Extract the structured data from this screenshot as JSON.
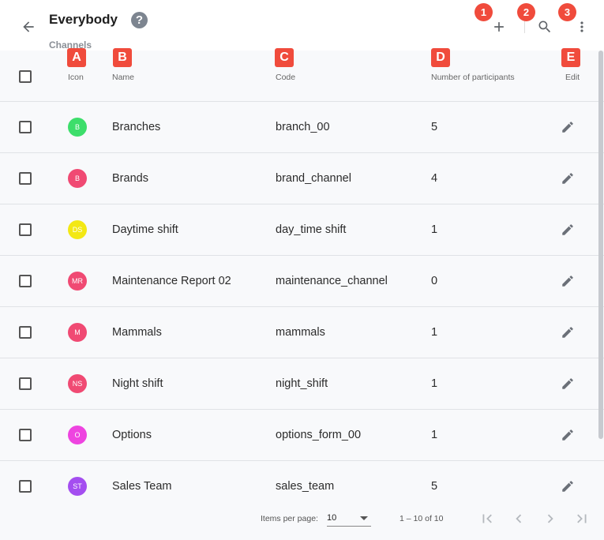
{
  "header": {
    "title": "Everybody",
    "help_glyph": "?",
    "subtitle": "Channels",
    "icons": {
      "back": "arrow-left-icon",
      "add": "plus-icon",
      "search": "search-icon",
      "more": "more-vert-icon"
    }
  },
  "markers": {
    "numbers": [
      "1",
      "2",
      "3"
    ],
    "letters": [
      "A",
      "B",
      "C",
      "D",
      "E"
    ]
  },
  "columns": [
    "Icon",
    "Name",
    "Code",
    "Number of participants",
    "Edit"
  ],
  "rows": [
    {
      "initials": "B",
      "color": "#3dde6b",
      "name": "Branches",
      "code": "branch_00",
      "participants": "5"
    },
    {
      "initials": "B",
      "color": "#f04a73",
      "name": "Brands",
      "code": "brand_channel",
      "participants": "4"
    },
    {
      "initials": "DS",
      "color": "#f3e814",
      "name": "Daytime shift",
      "code": "day_time shift",
      "participants": "1"
    },
    {
      "initials": "MR",
      "color": "#f04a73",
      "name": "Maintenance Report 02",
      "code": "maintenance_channel",
      "participants": "0"
    },
    {
      "initials": "M",
      "color": "#f04a73",
      "name": "Mammals",
      "code": "mammals",
      "participants": "1"
    },
    {
      "initials": "NS",
      "color": "#f04a73",
      "name": "Night shift",
      "code": "night_shift",
      "participants": "1"
    },
    {
      "initials": "O",
      "color": "#ee44e0",
      "name": "Options",
      "code": "options_form_00",
      "participants": "1"
    },
    {
      "initials": "ST",
      "color": "#a44ef0",
      "name": "Sales Team",
      "code": "sales_team",
      "participants": "5"
    }
  ],
  "pagination": {
    "items_per_page_label": "Items per page:",
    "items_per_page_value": "10",
    "range": "1 – 10 of 10",
    "icons": [
      "first-page-icon",
      "prev-page-icon",
      "next-page-icon",
      "last-page-icon"
    ]
  }
}
